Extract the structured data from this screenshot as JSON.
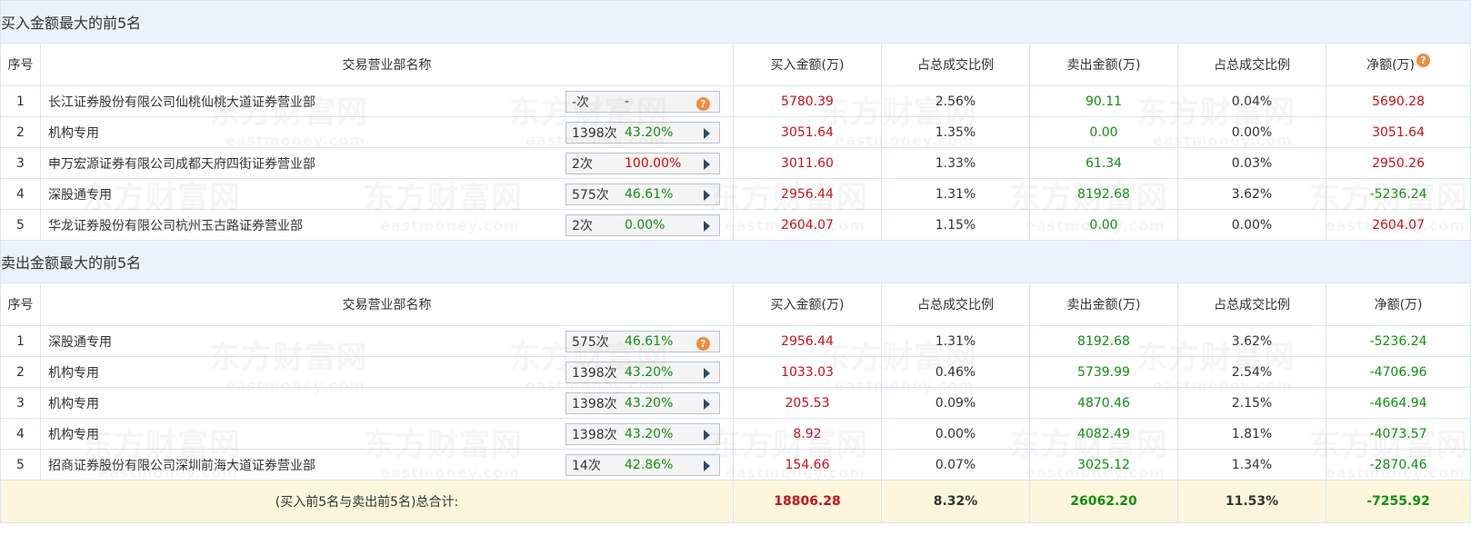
{
  "watermark": {
    "cn": "东方财富网",
    "en": "eastmoney.com"
  },
  "buy_section": {
    "title": "买入金额最大的前5名",
    "headers": {
      "seq": "序号",
      "name": "交易营业部名称",
      "buy": "买入金额(万)",
      "buy_ratio": "占总成交比例",
      "sell": "卖出金额(万)",
      "sell_ratio": "占总成交比例",
      "net": "净额(万)"
    },
    "rows": [
      {
        "seq": "1",
        "name": "长江证券股份有限公司仙桃仙桃大道证券营业部",
        "count": "-次",
        "pct": "-",
        "buy": "5780.39",
        "buy_ratio": "2.56%",
        "sell": "90.11",
        "sell_ratio": "0.04%",
        "net": "5690.28"
      },
      {
        "seq": "2",
        "name": "机构专用",
        "count": "1398次",
        "pct": "43.20%",
        "buy": "3051.64",
        "buy_ratio": "1.35%",
        "sell": "0.00",
        "sell_ratio": "0.00%",
        "net": "3051.64"
      },
      {
        "seq": "3",
        "name": "申万宏源证券有限公司成都天府四街证券营业部",
        "count": "2次",
        "pct": "100.00%",
        "buy": "3011.60",
        "buy_ratio": "1.33%",
        "sell": "61.34",
        "sell_ratio": "0.03%",
        "net": "2950.26"
      },
      {
        "seq": "4",
        "name": "深股通专用",
        "count": "575次",
        "pct": "46.61%",
        "buy": "2956.44",
        "buy_ratio": "1.31%",
        "sell": "8192.68",
        "sell_ratio": "3.62%",
        "net": "-5236.24"
      },
      {
        "seq": "5",
        "name": "华龙证券股份有限公司杭州玉古路证券营业部",
        "count": "2次",
        "pct": "0.00%",
        "buy": "2604.07",
        "buy_ratio": "1.15%",
        "sell": "0.00",
        "sell_ratio": "0.00%",
        "net": "2604.07"
      }
    ]
  },
  "sell_section": {
    "title": "卖出金额最大的前5名",
    "headers": {
      "seq": "序号",
      "name": "交易营业部名称",
      "buy": "买入金额(万)",
      "buy_ratio": "占总成交比例",
      "sell": "卖出金额(万)",
      "sell_ratio": "占总成交比例",
      "net": "净额(万)"
    },
    "rows": [
      {
        "seq": "1",
        "name": "深股通专用",
        "count": "575次",
        "pct": "46.61%",
        "buy": "2956.44",
        "buy_ratio": "1.31%",
        "sell": "8192.68",
        "sell_ratio": "3.62%",
        "net": "-5236.24"
      },
      {
        "seq": "2",
        "name": "机构专用",
        "count": "1398次",
        "pct": "43.20%",
        "buy": "1033.03",
        "buy_ratio": "0.46%",
        "sell": "5739.99",
        "sell_ratio": "2.54%",
        "net": "-4706.96"
      },
      {
        "seq": "3",
        "name": "机构专用",
        "count": "1398次",
        "pct": "43.20%",
        "buy": "205.53",
        "buy_ratio": "0.09%",
        "sell": "4870.46",
        "sell_ratio": "2.15%",
        "net": "-4664.94"
      },
      {
        "seq": "4",
        "name": "机构专用",
        "count": "1398次",
        "pct": "43.20%",
        "buy": "8.92",
        "buy_ratio": "0.00%",
        "sell": "4082.49",
        "sell_ratio": "1.81%",
        "net": "-4073.57"
      },
      {
        "seq": "5",
        "name": "招商证券股份有限公司深圳前海大道证券营业部",
        "count": "14次",
        "pct": "42.86%",
        "buy": "154.66",
        "buy_ratio": "0.07%",
        "sell": "3025.12",
        "sell_ratio": "1.34%",
        "net": "-2870.46"
      }
    ]
  },
  "total": {
    "label": "(买入前5名与卖出前5名)总合计:",
    "buy": "18806.28",
    "buy_ratio": "8.32%",
    "sell": "26062.20",
    "sell_ratio": "11.53%",
    "net": "-7255.92"
  },
  "colors": {
    "buy": "#c8101c",
    "sell": "#109010",
    "title_bg": "#eaf2fb",
    "total_bg": "#fdf6dc",
    "help_icon": "#f3893e"
  },
  "icons": {
    "help": "question-mark-icon",
    "expand": "play-arrow-icon"
  }
}
